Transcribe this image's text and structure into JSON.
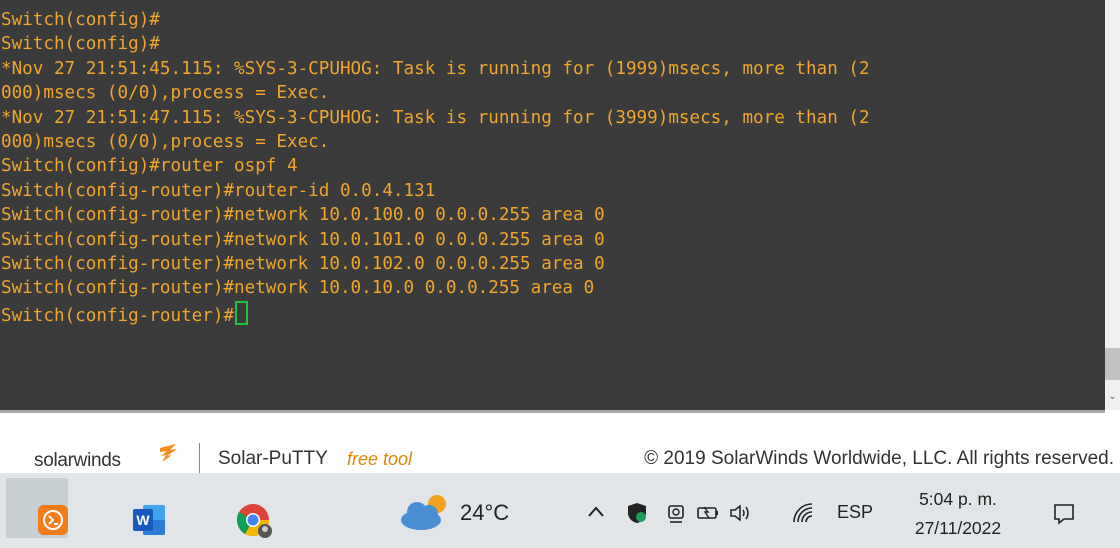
{
  "terminal": {
    "lines": [
      "Switch(config)#",
      "Switch(config)#",
      "*Nov 27 21:51:45.115: %SYS-3-CPUHOG: Task is running for (1999)msecs, more than (2",
      "000)msecs (0/0),process = Exec.",
      "*Nov 27 21:51:47.115: %SYS-3-CPUHOG: Task is running for (3999)msecs, more than (2",
      "000)msecs (0/0),process = Exec.",
      "Switch(config)#router ospf 4",
      "Switch(config-router)#router-id 0.0.4.131",
      "Switch(config-router)#network 10.0.100.0 0.0.0.255 area 0",
      "Switch(config-router)#network 10.0.101.0 0.0.0.255 area 0",
      "Switch(config-router)#network 10.0.102.0 0.0.0.255 area 0",
      "Switch(config-router)#network 10.0.10.0 0.0.0.255 area 0"
    ],
    "prompt": "Switch(config-router)#",
    "text_color": "#f0a52c",
    "cursor_color": "#1fc43a",
    "background": "#3b3b3b"
  },
  "footer": {
    "brand": "solarwinds",
    "app_name": "Solar-PuTTY",
    "free_tool": "free tool",
    "copyright": "© 2019 SolarWinds Worldwide, LLC. All rights reserved."
  },
  "taskbar": {
    "pinned_apps": [
      "solar-putty-icon",
      "word-icon",
      "chrome-icon"
    ],
    "weather_temp": "24°C",
    "language": "ESP",
    "clock_time": "5:04 p. m.",
    "clock_date": "27/11/2022"
  }
}
